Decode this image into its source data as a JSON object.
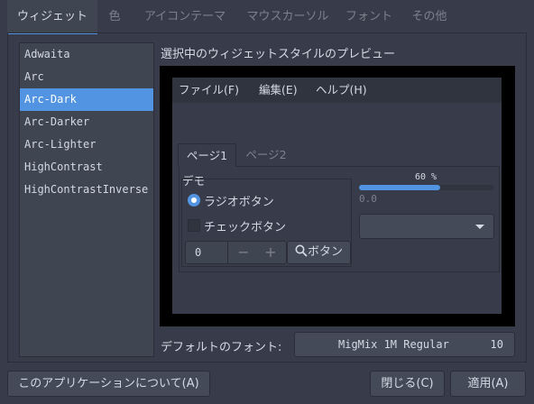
{
  "tabs": [
    "ウィジェット",
    "色",
    "アイコンテーマ",
    "マウスカーソル",
    "フォント",
    "その他"
  ],
  "themes": [
    "Adwaita",
    "Arc",
    "Arc-Dark",
    "Arc-Darker",
    "Arc-Lighter",
    "HighContrast",
    "HighContrastInverse"
  ],
  "selected_theme": "Arc-Dark",
  "preview": {
    "title": "選択中のウィジェットスタイルのプレビュー",
    "menu": [
      "ファイル(F)",
      "編集(E)",
      "ヘルプ(H)"
    ],
    "page_tabs": [
      "ページ1",
      "ページ2"
    ],
    "group_label": "デモ",
    "radio_label": "ラジオボタン",
    "check_label": "チェックボタン",
    "spin_value": "0",
    "spin_minus": "−",
    "spin_plus": "+",
    "search_button": "ボタン",
    "progress_text": "60 %",
    "progress_fraction": 0.6,
    "scale_value": "0.0"
  },
  "font": {
    "label": "デフォルトのフォント:",
    "name": "MigMix 1M Regular",
    "size": "10"
  },
  "buttons": {
    "about": "このアプリケーションについて(A)",
    "close": "閉じる(C)",
    "apply": "適用(A)"
  },
  "colors": {
    "accent": "#5294e2",
    "background": "#383c4a"
  },
  "icons": {
    "search": "search-icon",
    "dropdown": "chevron-down-icon"
  }
}
